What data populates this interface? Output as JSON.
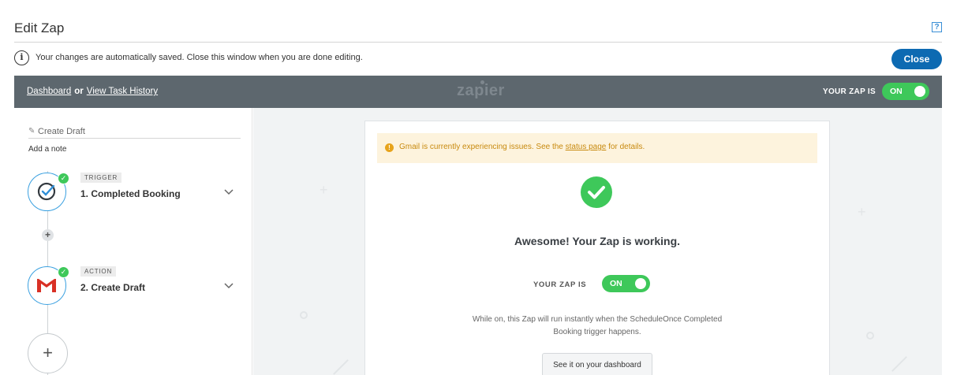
{
  "header": {
    "title": "Edit Zap",
    "help_label": "?"
  },
  "info_bar": {
    "icon_glyph": "i",
    "text": "Your changes are automatically saved. Close this window when you are done editing.",
    "close_label": "Close"
  },
  "top_bar": {
    "dashboard_link": "Dashboard",
    "or_text": "or",
    "task_history_link": "View Task History",
    "logo_text": "zapier",
    "zap_status_label": "YOUR ZAP IS",
    "toggle_label": "ON"
  },
  "sidebar": {
    "draft_name": "Create Draft",
    "add_note": "Add a note",
    "steps": [
      {
        "tag": "TRIGGER",
        "title": "1. Completed Booking",
        "icon": "scheduleonce-check-icon"
      },
      {
        "tag": "ACTION",
        "title": "2. Create Draft",
        "icon": "gmail-icon"
      }
    ],
    "add_step_glyph": "+"
  },
  "card": {
    "alert": {
      "prefix": "Gmail is currently experiencing issues. See the",
      "link": "status page",
      "suffix": "for details."
    },
    "title": "Awesome! Your Zap is working.",
    "zap_status_label": "YOUR ZAP IS",
    "toggle_label": "ON",
    "description": "While on, this Zap will run instantly when the ScheduleOnce Completed Booking trigger happens.",
    "dashboard_button": "See it on your dashboard"
  },
  "colors": {
    "primary_blue": "#0d6ab2",
    "toggle_green": "#3ec85a",
    "topbar_gray": "#5d676e",
    "alert_bg": "#fdf3dd",
    "alert_text": "#c88a0f"
  }
}
